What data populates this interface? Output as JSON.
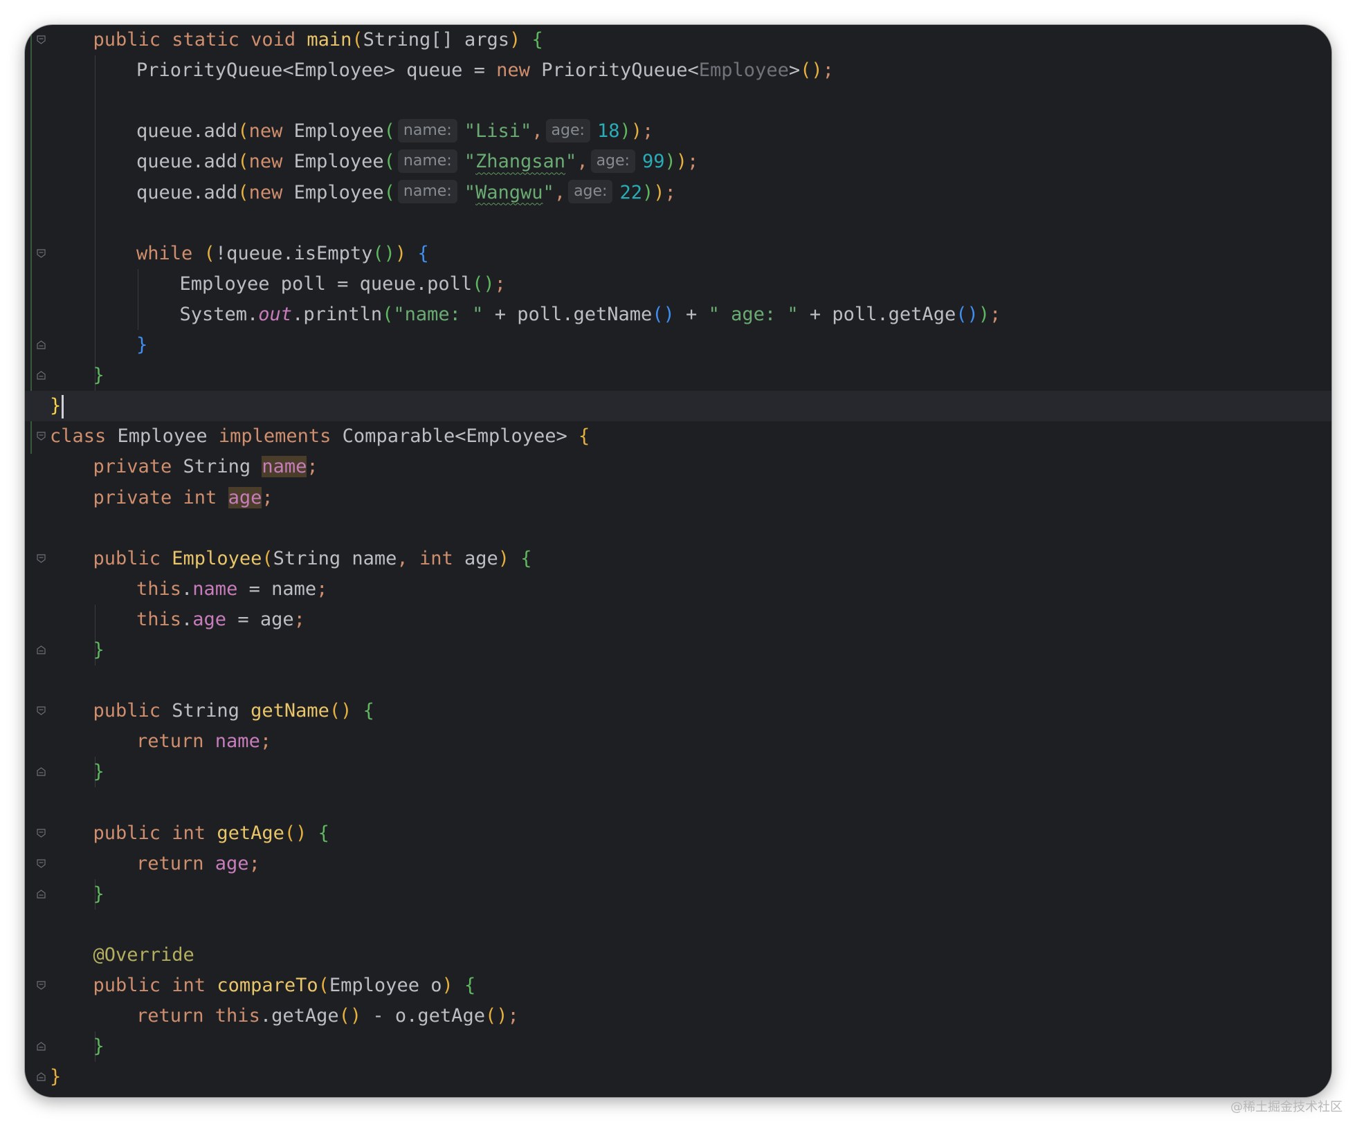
{
  "editor": {
    "lines": [
      {
        "indent": 1,
        "fold": "open",
        "tokens": [
          {
            "t": "public ",
            "c": "kw"
          },
          {
            "t": "static ",
            "c": "kw"
          },
          {
            "t": "void ",
            "c": "kw"
          },
          {
            "t": "main",
            "c": "fn"
          },
          {
            "t": "(",
            "c": "p-or"
          },
          {
            "t": "String[] args"
          },
          {
            "t": ")",
            "c": "p-or"
          },
          {
            "t": " "
          },
          {
            "t": "{",
            "c": "p-gr"
          }
        ]
      },
      {
        "indent": 2,
        "tokens": [
          {
            "t": "PriorityQueue<Employee> queue = "
          },
          {
            "t": "new ",
            "c": "kw"
          },
          {
            "t": "PriorityQueue<"
          },
          {
            "t": "Employee",
            "c": "dim"
          },
          {
            "t": ">"
          },
          {
            "t": "()",
            "c": "p-or"
          },
          {
            "t": ";",
            "c": "kw"
          }
        ]
      },
      {
        "indent": 0,
        "tokens": []
      },
      {
        "indent": 2,
        "tokens": [
          {
            "t": "queue.add"
          },
          {
            "t": "(",
            "c": "p-or"
          },
          {
            "t": "new ",
            "c": "kw"
          },
          {
            "t": "Employee"
          },
          {
            "t": "(",
            "c": "p-gr"
          },
          {
            "hint": "name:"
          },
          {
            "t": "\"Lisi\"",
            "c": "str"
          },
          {
            "t": ",",
            "c": "kw"
          },
          {
            "hint": "age:"
          },
          {
            "t": "18",
            "c": "num"
          },
          {
            "t": ")",
            "c": "p-gr"
          },
          {
            "t": ")",
            "c": "p-or"
          },
          {
            "t": ";",
            "c": "kw"
          }
        ]
      },
      {
        "indent": 2,
        "tokens": [
          {
            "t": "queue.add"
          },
          {
            "t": "(",
            "c": "p-or"
          },
          {
            "t": "new ",
            "c": "kw"
          },
          {
            "t": "Employee"
          },
          {
            "t": "(",
            "c": "p-gr"
          },
          {
            "hint": "name:"
          },
          {
            "t": "\"",
            "c": "str"
          },
          {
            "t": "Zhangsan",
            "c": "str uwave"
          },
          {
            "t": "\"",
            "c": "str"
          },
          {
            "t": ",",
            "c": "kw"
          },
          {
            "hint": "age:"
          },
          {
            "t": "99",
            "c": "num"
          },
          {
            "t": ")",
            "c": "p-gr"
          },
          {
            "t": ")",
            "c": "p-or"
          },
          {
            "t": ";",
            "c": "kw"
          }
        ]
      },
      {
        "indent": 2,
        "tokens": [
          {
            "t": "queue.add"
          },
          {
            "t": "(",
            "c": "p-or"
          },
          {
            "t": "new ",
            "c": "kw"
          },
          {
            "t": "Employee"
          },
          {
            "t": "(",
            "c": "p-gr"
          },
          {
            "hint": "name:"
          },
          {
            "t": "\"",
            "c": "str"
          },
          {
            "t": "Wangwu",
            "c": "str uwave"
          },
          {
            "t": "\"",
            "c": "str"
          },
          {
            "t": ",",
            "c": "kw"
          },
          {
            "hint": "age:"
          },
          {
            "t": "22",
            "c": "num"
          },
          {
            "t": ")",
            "c": "p-gr"
          },
          {
            "t": ")",
            "c": "p-or"
          },
          {
            "t": ";",
            "c": "kw"
          }
        ]
      },
      {
        "indent": 0,
        "tokens": []
      },
      {
        "indent": 2,
        "fold": "open",
        "tokens": [
          {
            "t": "while ",
            "c": "kw"
          },
          {
            "t": "(",
            "c": "p-or"
          },
          {
            "t": "!queue.isEmpty"
          },
          {
            "t": "()",
            "c": "p-gr"
          },
          {
            "t": ")",
            "c": "p-or"
          },
          {
            "t": " "
          },
          {
            "t": "{",
            "c": "p-bl"
          }
        ]
      },
      {
        "indent": 3,
        "tokens": [
          {
            "t": "Employee poll = queue.poll"
          },
          {
            "t": "()",
            "c": "p-gr"
          },
          {
            "t": ";",
            "c": "kw"
          }
        ]
      },
      {
        "indent": 3,
        "tokens": [
          {
            "t": "System."
          },
          {
            "t": "out",
            "c": "ital"
          },
          {
            "t": ".println"
          },
          {
            "t": "(",
            "c": "p-gr"
          },
          {
            "t": "\"name: \"",
            "c": "str"
          },
          {
            "t": " + poll.getName"
          },
          {
            "t": "()",
            "c": "p-bl"
          },
          {
            "t": " + "
          },
          {
            "t": "\" age: \"",
            "c": "str"
          },
          {
            "t": " + poll.getAge"
          },
          {
            "t": "()",
            "c": "p-bl"
          },
          {
            "t": ")",
            "c": "p-gr"
          },
          {
            "t": ";",
            "c": "kw"
          }
        ]
      },
      {
        "indent": 2,
        "fold": "close",
        "tokens": [
          {
            "t": "}",
            "c": "p-bl"
          }
        ]
      },
      {
        "indent": 1,
        "fold": "close",
        "tokens": [
          {
            "t": "}",
            "c": "p-gr"
          }
        ]
      },
      {
        "indent": 0,
        "fold": "close",
        "current": true,
        "caret": true,
        "tokens": [
          {
            "t": "}",
            "c": "p-yl"
          }
        ]
      },
      {
        "indent": 0,
        "fold": "open",
        "tokens": [
          {
            "t": "class ",
            "c": "kw"
          },
          {
            "t": "Employee "
          },
          {
            "t": "implements ",
            "c": "kw"
          },
          {
            "t": "Comparable<Employee> "
          },
          {
            "t": "{",
            "c": "p-or"
          }
        ]
      },
      {
        "indent": 1,
        "tokens": [
          {
            "t": "private ",
            "c": "kw"
          },
          {
            "t": "String "
          },
          {
            "t": "name",
            "c": "fld hl"
          },
          {
            "t": ";",
            "c": "kw"
          }
        ]
      },
      {
        "indent": 1,
        "tokens": [
          {
            "t": "private ",
            "c": "kw"
          },
          {
            "t": "int ",
            "c": "kw"
          },
          {
            "t": "age",
            "c": "fld hl"
          },
          {
            "t": ";",
            "c": "kw"
          }
        ]
      },
      {
        "indent": 0,
        "tokens": []
      },
      {
        "indent": 1,
        "fold": "open",
        "tokens": [
          {
            "t": "public ",
            "c": "kw"
          },
          {
            "t": "Employee",
            "c": "fn"
          },
          {
            "t": "(",
            "c": "p-or"
          },
          {
            "t": "String name"
          },
          {
            "t": ", ",
            "c": "kw"
          },
          {
            "t": "int ",
            "c": "kw"
          },
          {
            "t": "age"
          },
          {
            "t": ")",
            "c": "p-or"
          },
          {
            "t": " "
          },
          {
            "t": "{",
            "c": "p-gr"
          }
        ]
      },
      {
        "indent": 2,
        "tokens": [
          {
            "t": "this",
            "c": "kw"
          },
          {
            "t": "."
          },
          {
            "t": "name",
            "c": "fld"
          },
          {
            "t": " = name"
          },
          {
            "t": ";",
            "c": "kw"
          }
        ]
      },
      {
        "indent": 2,
        "tokens": [
          {
            "t": "this",
            "c": "kw"
          },
          {
            "t": "."
          },
          {
            "t": "age",
            "c": "fld"
          },
          {
            "t": " = age"
          },
          {
            "t": ";",
            "c": "kw"
          }
        ]
      },
      {
        "indent": 1,
        "fold": "close",
        "tokens": [
          {
            "t": "}",
            "c": "p-gr"
          }
        ]
      },
      {
        "indent": 0,
        "tokens": []
      },
      {
        "indent": 1,
        "fold": "open",
        "tokens": [
          {
            "t": "public ",
            "c": "kw"
          },
          {
            "t": "String "
          },
          {
            "t": "getName",
            "c": "fn"
          },
          {
            "t": "()",
            "c": "p-or"
          },
          {
            "t": " "
          },
          {
            "t": "{",
            "c": "p-gr"
          }
        ]
      },
      {
        "indent": 2,
        "tokens": [
          {
            "t": "return ",
            "c": "kw"
          },
          {
            "t": "name",
            "c": "fld"
          },
          {
            "t": ";",
            "c": "kw"
          }
        ]
      },
      {
        "indent": 1,
        "fold": "close",
        "tokens": [
          {
            "t": "}",
            "c": "p-gr"
          }
        ]
      },
      {
        "indent": 0,
        "tokens": []
      },
      {
        "indent": 1,
        "fold": "open",
        "tokens": [
          {
            "t": "public ",
            "c": "kw"
          },
          {
            "t": "int ",
            "c": "kw"
          },
          {
            "t": "getAge",
            "c": "fn"
          },
          {
            "t": "()",
            "c": "p-or"
          },
          {
            "t": " "
          },
          {
            "t": "{",
            "c": "p-gr"
          }
        ]
      },
      {
        "indent": 2,
        "fold": "open",
        "tokens": [
          {
            "t": "return ",
            "c": "kw"
          },
          {
            "t": "age",
            "c": "fld"
          },
          {
            "t": ";",
            "c": "kw"
          }
        ]
      },
      {
        "indent": 1,
        "fold": "close",
        "tokens": [
          {
            "t": "}",
            "c": "p-gr"
          }
        ]
      },
      {
        "indent": 0,
        "tokens": []
      },
      {
        "indent": 1,
        "tokens": [
          {
            "t": "@Override",
            "c": "ann"
          }
        ]
      },
      {
        "indent": 1,
        "fold": "open",
        "tokens": [
          {
            "t": "public ",
            "c": "kw"
          },
          {
            "t": "int ",
            "c": "kw"
          },
          {
            "t": "compareTo",
            "c": "fn"
          },
          {
            "t": "(",
            "c": "p-or"
          },
          {
            "t": "Employee o"
          },
          {
            "t": ")",
            "c": "p-or"
          },
          {
            "t": " "
          },
          {
            "t": "{",
            "c": "p-gr"
          }
        ]
      },
      {
        "indent": 2,
        "tokens": [
          {
            "t": "return ",
            "c": "kw"
          },
          {
            "t": "this",
            "c": "kw"
          },
          {
            "t": ".getAge"
          },
          {
            "t": "()",
            "c": "p-or"
          },
          {
            "t": " - o.getAge"
          },
          {
            "t": "()",
            "c": "p-or"
          },
          {
            "t": ";",
            "c": "kw"
          }
        ]
      },
      {
        "indent": 1,
        "fold": "close",
        "tokens": [
          {
            "t": "}",
            "c": "p-gr"
          }
        ]
      },
      {
        "indent": 0,
        "fold": "close",
        "tokens": [
          {
            "t": "}",
            "c": "p-or"
          }
        ]
      }
    ]
  },
  "watermark": "@稀土掘金技术社区",
  "colors": {
    "background": "#1e1f22",
    "keyword": "#cf8e6d",
    "function": "#e8c46a",
    "string": "#6aab73",
    "number": "#2aacb8",
    "field": "#c77dbb"
  }
}
